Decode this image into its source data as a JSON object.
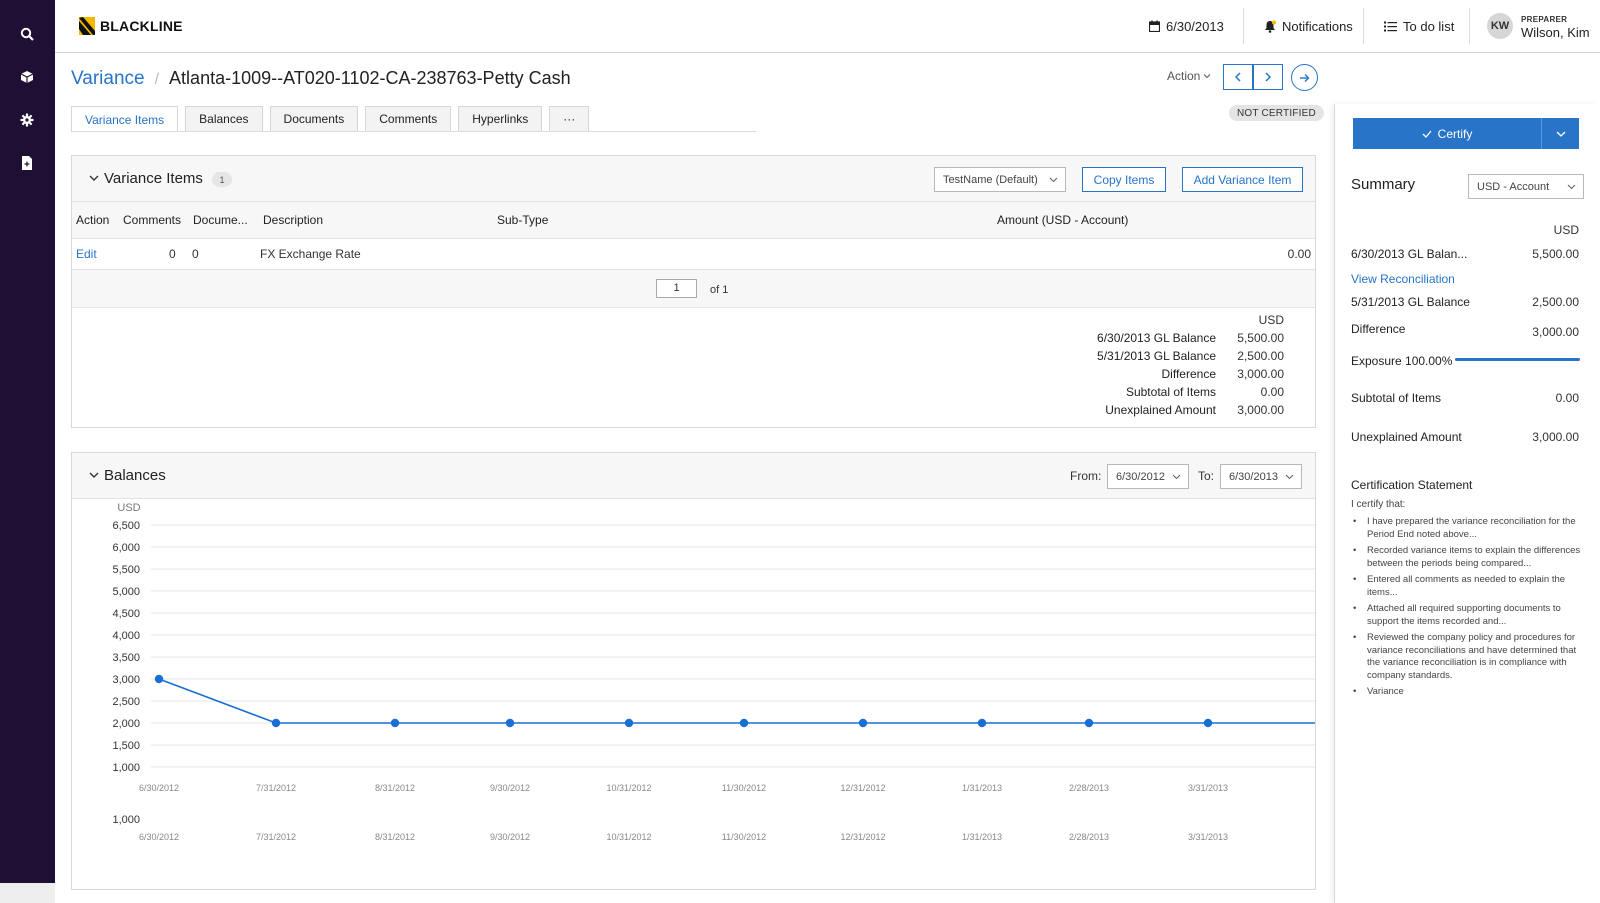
{
  "brand": {
    "name": "BLACKLINE"
  },
  "topbar": {
    "date": "6/30/2013",
    "notifications": "Notifications",
    "todo": "To do list",
    "user_initials": "KW",
    "role_label": "PREPARER",
    "user_name": "Wilson, Kim"
  },
  "breadcrumb": {
    "section": "Variance",
    "separator": "/",
    "account": "Atlanta-1009--AT020-1102-CA-238763-Petty Cash"
  },
  "header": {
    "action_label": "Action",
    "status_badge": "NOT CERTIFIED"
  },
  "tabs": [
    {
      "label": "Variance Items",
      "active": true
    },
    {
      "label": "Balances"
    },
    {
      "label": "Documents"
    },
    {
      "label": "Comments"
    },
    {
      "label": "Hyperlinks"
    },
    {
      "label": "···"
    }
  ],
  "variance_items": {
    "title": "Variance Items",
    "count": "1",
    "view_select": "TestName (Default)",
    "copy_button": "Copy Items",
    "add_button": "Add Variance Item",
    "columns": [
      "Action",
      "Comments",
      "Docume...",
      "Description",
      "Sub-Type",
      "Amount (USD - Account)"
    ],
    "rows": [
      {
        "action": "Edit",
        "comments": "0",
        "documents": "0",
        "description": "FX Exchange Rate",
        "subtype": "",
        "amount": "0.00"
      }
    ],
    "page": "1",
    "page_of": "of 1",
    "summary_currency": "USD",
    "summary": [
      {
        "label": "6/30/2013 GL Balance",
        "value": "5,500.00"
      },
      {
        "label": "5/31/2013 GL Balance",
        "value": "2,500.00"
      },
      {
        "label": "Difference",
        "value": "3,000.00"
      },
      {
        "label": "Subtotal of Items",
        "value": "0.00"
      },
      {
        "label": "Unexplained Amount",
        "value": "3,000.00"
      }
    ]
  },
  "balances": {
    "title": "Balances",
    "from_label": "From:",
    "from_value": "6/30/2012",
    "to_label": "To:",
    "to_value": "6/30/2013"
  },
  "chart_data": {
    "type": "line",
    "ylabel": "USD",
    "ylim": [
      1000,
      6500
    ],
    "yticks": [
      "6,500",
      "6,000",
      "5,500",
      "5,000",
      "4,500",
      "4,000",
      "3,500",
      "3,000",
      "2,500",
      "2,000",
      "1,500",
      "1,000"
    ],
    "x": [
      "6/30/2012",
      "7/31/2012",
      "8/31/2012",
      "9/30/2012",
      "10/31/2012",
      "11/30/2012",
      "12/31/2012",
      "1/31/2013",
      "2/28/2013",
      "3/31/2013"
    ],
    "series": [
      {
        "values": [
          3000,
          2000,
          2000,
          2000,
          2000,
          2000,
          2000,
          2000,
          2000,
          2000
        ],
        "color": "#1a6fd4"
      }
    ],
    "overview_ytick": "1,000",
    "grid": true,
    "legend": "none"
  },
  "sidebar": {
    "certify_label": "Certify",
    "summary_title": "Summary",
    "currency_select": "USD - Account",
    "currency": "USD",
    "rows": [
      {
        "label": "6/30/2013 GL Balan...",
        "value": "5,500.00"
      },
      {
        "label": "5/31/2013 GL Balance",
        "value": "2,500.00"
      },
      {
        "label": "Difference",
        "value": "3,000.00"
      },
      {
        "label": "Subtotal of Items",
        "value": "0.00"
      },
      {
        "label": "Unexplained Amount",
        "value": "3,000.00"
      }
    ],
    "view_reconciliation": "View Reconciliation",
    "exposure_label": "Exposure 100.00%",
    "exposure_pct": 100,
    "cert_title": "Certification Statement",
    "cert_intro": "I certify that:",
    "cert_items": [
      "I have prepared the variance reconciliation for the Period End noted above...",
      "Recorded variance items to explain the differences between the periods being compared...",
      "Entered all comments as needed to explain the items...",
      "Attached all required supporting documents to support the items recorded and...",
      "Reviewed the company policy and procedures for variance reconciliations and have determined that the variance reconciliation is in compliance with company standards.",
      "Variance"
    ]
  },
  "colors": {
    "accent": "#2774c8",
    "rail": "#1f0f35",
    "logo_accent": "#f5b800"
  }
}
